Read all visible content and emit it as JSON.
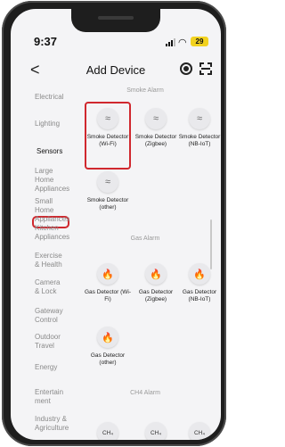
{
  "status": {
    "time": "9:37",
    "battery": "29"
  },
  "header": {
    "title": "Add Device",
    "back": "<"
  },
  "sidebar": {
    "items": [
      {
        "label": "Electrical"
      },
      {
        "label": "Lighting"
      },
      {
        "label": "Sensors"
      },
      {
        "label": "Large Home Appliances"
      },
      {
        "label": "Small Home Appliances"
      },
      {
        "label": "Kitchen Appliances"
      },
      {
        "label": "Exercise & Health"
      },
      {
        "label": "Camera & Lock"
      },
      {
        "label": "Gateway Control"
      },
      {
        "label": "Outdoor Travel"
      },
      {
        "label": "Energy"
      },
      {
        "label": "Entertainment"
      },
      {
        "label": "Industry & Agriculture"
      }
    ]
  },
  "sections": {
    "smoke": {
      "title": "Smoke  Alarm",
      "devices": [
        {
          "label": "Smoke Detector (Wi-Fi)"
        },
        {
          "label": "Smoke Detector (Zigbee)"
        },
        {
          "label": "Smoke Detector (NB-IoT)"
        },
        {
          "label": "Smoke Detector (other)"
        }
      ]
    },
    "gas": {
      "title": "Gas Alarm",
      "devices": [
        {
          "label": "Gas Detector (Wi-Fi)"
        },
        {
          "label": "Gas Detector (Zigbee)"
        },
        {
          "label": "Gas Detector (NB-IoT)"
        },
        {
          "label": "Gas Detector (other)"
        }
      ]
    },
    "ch4": {
      "title": "CH4 Alarm",
      "devices": [
        {
          "icon_text": "CH₄"
        },
        {
          "icon_text": "CH₄"
        },
        {
          "icon_text": "CH₄"
        }
      ]
    }
  },
  "colors": {
    "highlight": "#d0282e",
    "battery": "#f2d21f"
  }
}
